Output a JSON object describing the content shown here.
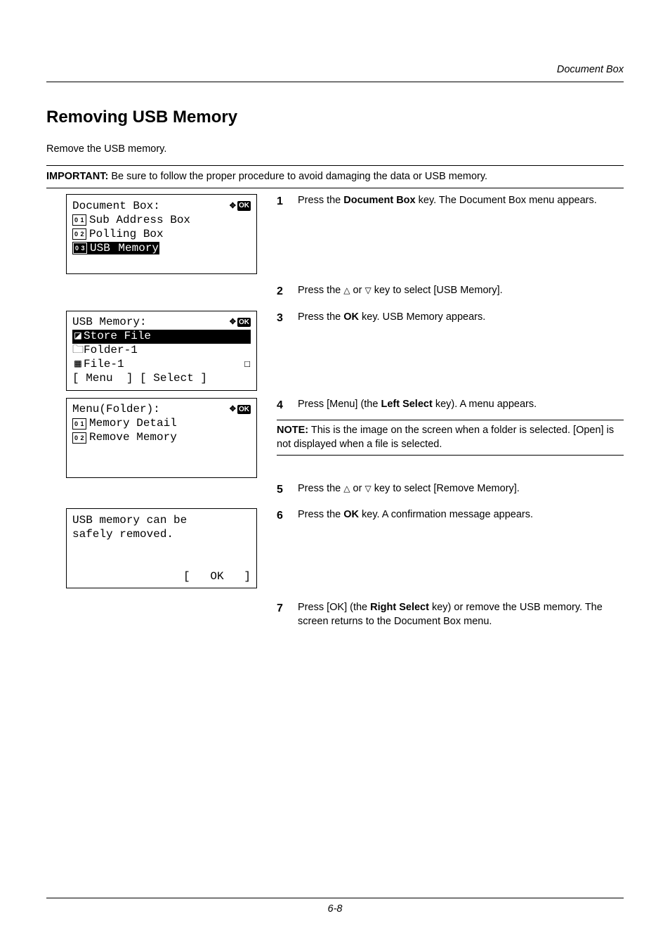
{
  "running_head": "Document Box",
  "title": "Removing USB Memory",
  "intro": "Remove the USB memory.",
  "important": {
    "label": "IMPORTANT:",
    "text": " Be sure to follow the proper procedure to avoid damaging the data or USB memory."
  },
  "lcd1": {
    "title": "Document Box:",
    "items": [
      {
        "num": "0 1",
        "label": "Sub Address Box",
        "hl": false
      },
      {
        "num": "0 2",
        "label": "Polling Box",
        "hl": false
      },
      {
        "num": "0 3",
        "label": "USB Memory",
        "hl": true,
        "label_prefix": "USB",
        "label_rest": " Memory"
      }
    ]
  },
  "lcd2": {
    "title": "USB Memory:",
    "row1": {
      "icon": "store-file-icon",
      "label": "Store File",
      "hl": true
    },
    "row2": {
      "icon": "folder-icon",
      "label": "Folder-1"
    },
    "row3": {
      "icon": "file-icon",
      "label": "File-1",
      "check": "☐"
    },
    "softkeys": "[ Menu  ] [ Select ]"
  },
  "lcd3": {
    "title": "Menu(Folder):",
    "items": [
      {
        "num": "0 1",
        "label": "Memory Detail"
      },
      {
        "num": "0 2",
        "label": "Remove Memory"
      }
    ]
  },
  "lcd4": {
    "line1": "USB memory can be",
    "line2": "safely removed.",
    "ok": "[   OK   ]"
  },
  "steps": {
    "s1": {
      "num": "1",
      "pre": "Press the ",
      "key": "Document Box",
      "post": " key. The Document Box menu appears."
    },
    "s2": {
      "num": "2",
      "pre": "Press the ",
      "tri1": "△",
      "mid": " or ",
      "tri2": "▽",
      "post": " key to select [USB Memory]."
    },
    "s3": {
      "num": "3",
      "pre": "Press the ",
      "key": "OK",
      "post": " key. USB Memory appears."
    },
    "s4": {
      "num": "4",
      "pre": "Press [Menu] (the ",
      "key": "Left Select",
      "post": " key). A menu appears."
    },
    "note": {
      "label": "NOTE:",
      "text": " This is the image on the screen when a folder is selected. [Open] is not displayed when a file is selected."
    },
    "s5": {
      "num": "5",
      "pre": "Press the ",
      "tri1": "△",
      "mid": " or ",
      "tri2": "▽",
      "post": " key to select [Remove Memory]."
    },
    "s6": {
      "num": "6",
      "pre": "Press the ",
      "key": "OK",
      "post": " key. A confirmation message appears."
    },
    "s7": {
      "num": "7",
      "pre": "Press [OK] (the ",
      "key": "Right Select",
      "post": " key) or remove the USB memory. The screen returns to the Document Box menu."
    }
  },
  "footer": "6-8",
  "ok_label": "OK"
}
